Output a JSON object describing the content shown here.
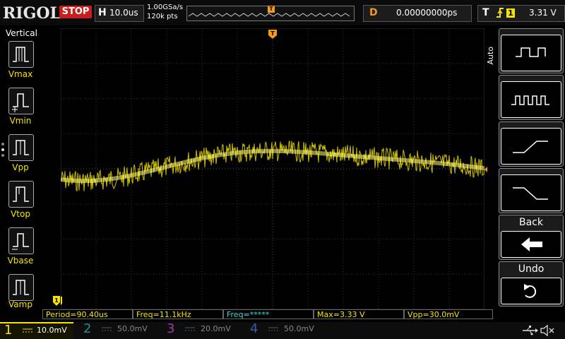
{
  "header": {
    "logo": "RIGOL",
    "run_state": "STOP",
    "timebase": {
      "letter": "H",
      "value": "10.0us"
    },
    "sample_rate": "1.00GSa/s",
    "memory_depth": "120k pts",
    "trigger_marker": "T",
    "delay": {
      "letter": "D",
      "value": "0.00000000ps"
    },
    "trigger": {
      "letter": "T",
      "edge_icon": "rising-edge-icon",
      "source": "1",
      "level": "3.31 V"
    }
  },
  "left_panel": {
    "title": "Vertical",
    "measurements": [
      {
        "label": "Vmax",
        "icon": "vmax-icon"
      },
      {
        "label": "Vmin",
        "icon": "vmin-icon"
      },
      {
        "label": "Vpp",
        "icon": "vpp-icon"
      },
      {
        "label": "Vtop",
        "icon": "vtop-icon"
      },
      {
        "label": "Vbase",
        "icon": "vbase-icon"
      },
      {
        "label": "Vamp",
        "icon": "vamp-icon"
      }
    ]
  },
  "right_panel": {
    "mode": "Auto",
    "buttons": [
      {
        "icon": "single-pulse-icon"
      },
      {
        "icon": "multi-pulse-icon"
      },
      {
        "icon": "rising-ramp-icon"
      },
      {
        "icon": "falling-ramp-icon"
      },
      {
        "label": "Back",
        "icon": "back-arrow-icon"
      },
      {
        "label": "Undo",
        "icon": "undo-icon"
      }
    ]
  },
  "measurement_bar": [
    {
      "text": "Period=90.40us",
      "color": "#f5e400"
    },
    {
      "text": "Freq=11.1kHz",
      "color": "#f5e400"
    },
    {
      "text": "Freq=*****",
      "color": "#3fd7e0"
    },
    {
      "text": "Max=3.33 V",
      "color": "#f5e400"
    },
    {
      "text": "Vpp=30.0mV",
      "color": "#f5e400"
    }
  ],
  "channels": [
    {
      "num": "1",
      "scale": "10.0mV",
      "color": "#f5e400",
      "active": true
    },
    {
      "num": "2",
      "scale": "50.0mV",
      "color": "#2a8a8a",
      "active": false
    },
    {
      "num": "3",
      "scale": "20.0mV",
      "color": "#a03aa0",
      "active": false
    },
    {
      "num": "4",
      "scale": "50.0mV",
      "color": "#3a5aa8",
      "active": false
    }
  ],
  "status_icons": [
    "usb-icon",
    "speaker-muted-icon"
  ],
  "colors": {
    "ch1": "#f5e400",
    "trigger_marker": "#f39c12",
    "stop": "#c81e1e"
  }
}
